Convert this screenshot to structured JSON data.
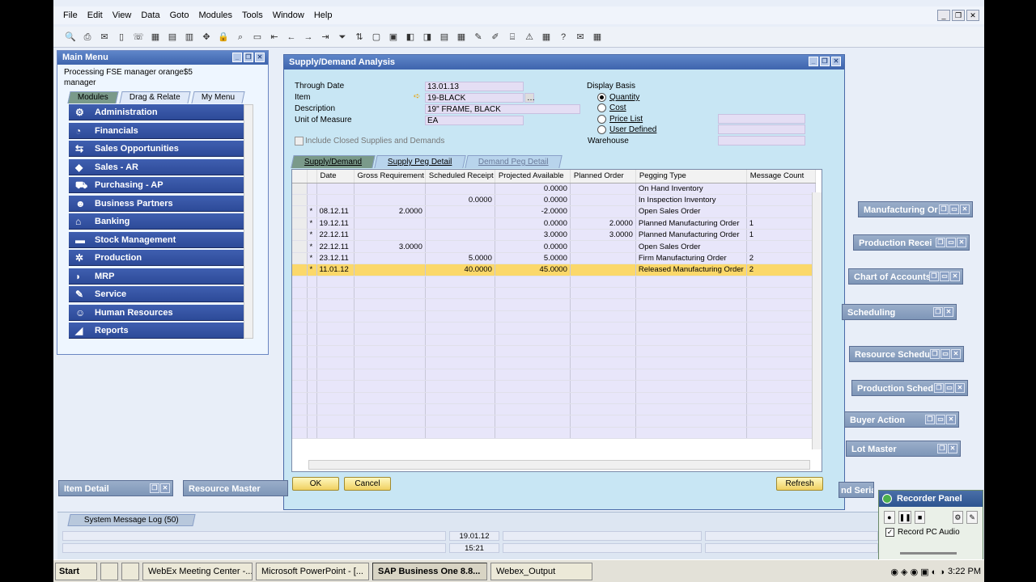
{
  "menubar": [
    "File",
    "Edit",
    "View",
    "Data",
    "Goto",
    "Modules",
    "Tools",
    "Window",
    "Help"
  ],
  "main_menu": {
    "title": "Main Menu",
    "info_line1": "Processing FSE manager orange$5",
    "info_line2": "manager",
    "tabs": [
      "Modules",
      "Drag & Relate",
      "My Menu"
    ],
    "items": [
      "Administration",
      "Financials",
      "Sales Opportunities",
      "Sales - AR",
      "Purchasing - AP",
      "Business Partners",
      "Banking",
      "Stock Management",
      "Production",
      "MRP",
      "Service",
      "Human Resources",
      "Reports"
    ]
  },
  "sd": {
    "title": "Supply/Demand Analysis",
    "through_date_label": "Through Date",
    "through_date": "13.01.13",
    "item_label": "Item",
    "item": "19-BLACK",
    "desc_label": "Description",
    "desc": "19\" FRAME, BLACK",
    "uom_label": "Unit of Measure",
    "uom": "EA",
    "include_closed": "Include Closed Supplies and Demands",
    "display_basis": "Display Basis",
    "radios": [
      "Quantity",
      "Cost",
      "Price List",
      "User Defined"
    ],
    "warehouse_label": "Warehouse",
    "tabs": [
      "Supply/Demand",
      "Supply Peg Detail",
      "Demand Peg Detail"
    ],
    "columns": [
      "Date",
      "Gross Requirement",
      "Scheduled Receipt",
      "Projected Available",
      "Planned Order",
      "Pegging Type",
      "Message Count"
    ],
    "rows": [
      {
        "mark": "",
        "date": "",
        "gross": "",
        "sched": "",
        "proj": "0.0000",
        "planned": "",
        "type": "On Hand Inventory",
        "msg": ""
      },
      {
        "mark": "",
        "date": "",
        "gross": "",
        "sched": "0.0000",
        "proj": "0.0000",
        "planned": "",
        "type": "In Inspection Inventory",
        "msg": ""
      },
      {
        "mark": "*",
        "date": "08.12.11",
        "gross": "2.0000",
        "sched": "",
        "proj": "-2.0000",
        "planned": "",
        "type": "Open Sales Order",
        "msg": ""
      },
      {
        "mark": "*",
        "date": "19.12.11",
        "gross": "",
        "sched": "",
        "proj": "0.0000",
        "planned": "2.0000",
        "type": "Planned Manufacturing Order",
        "msg": "1"
      },
      {
        "mark": "*",
        "date": "22.12.11",
        "gross": "",
        "sched": "",
        "proj": "3.0000",
        "planned": "3.0000",
        "type": "Planned Manufacturing Order",
        "msg": "1"
      },
      {
        "mark": "*",
        "date": "22.12.11",
        "gross": "3.0000",
        "sched": "",
        "proj": "0.0000",
        "planned": "",
        "type": "Open Sales Order",
        "msg": ""
      },
      {
        "mark": "*",
        "date": "23.12.11",
        "gross": "",
        "sched": "5.0000",
        "proj": "5.0000",
        "planned": "",
        "type": "Firm Manufacturing Order",
        "msg": "2"
      },
      {
        "mark": "*",
        "date": "11.01.12",
        "gross": "",
        "sched": "40.0000",
        "proj": "45.0000",
        "planned": "",
        "type": "Released Manufacturing Order",
        "msg": "2"
      }
    ],
    "ok": "OK",
    "cancel": "Cancel",
    "refresh": "Refresh"
  },
  "minimized": {
    "manufacturing": "Manufacturing Or",
    "production_receipt": "Production Recei",
    "chart_of_accounts": "Chart of Accounts",
    "scheduling": "Scheduling",
    "resource_sched": "Resource Schedu",
    "production_sched": "Production Sched",
    "buyer_action": "Buyer Action",
    "lot_master": "Lot Master",
    "item_detail": "Item Detail",
    "resource_master": "Resource Master",
    "and_serial": "nd Serial N"
  },
  "status": {
    "msglog": "System Message Log (50)",
    "date": "19.01.12",
    "time": "15:21"
  },
  "recorder": {
    "title": "Recorder Panel",
    "record_audio": "Record PC Audio"
  },
  "taskbar": {
    "start": "Start",
    "tasks": [
      "WebEx Meeting Center -...",
      "Microsoft PowerPoint - [...",
      "SAP Business One 8.8...",
      "Webex_Output"
    ],
    "clock": "3:22 PM"
  }
}
